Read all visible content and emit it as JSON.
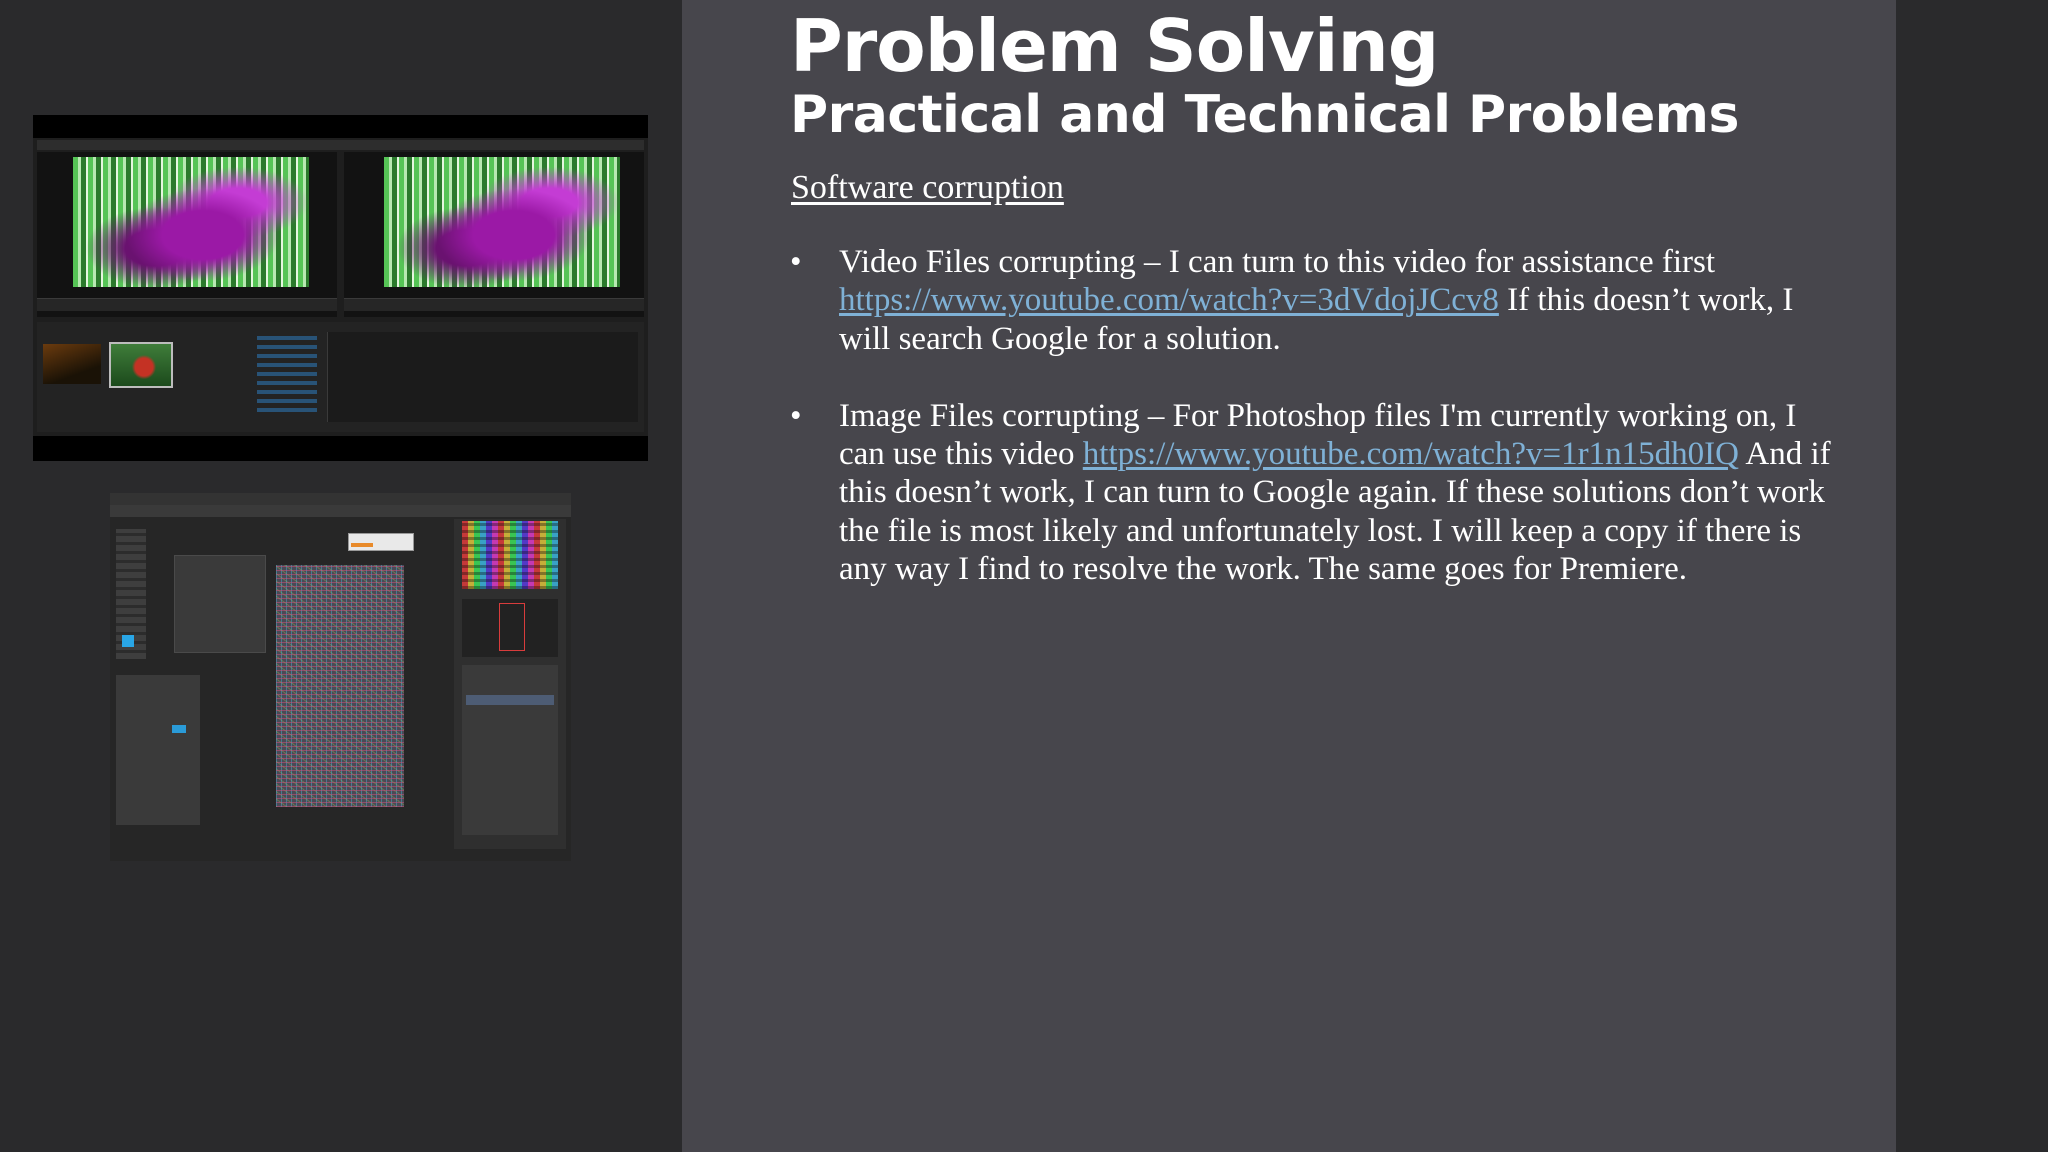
{
  "slide": {
    "title": "Problem Solving",
    "subtitle": "Practical and Technical Problems",
    "section_heading": "Software corruption",
    "bullets": [
      {
        "before": "Video Files corrupting – I can turn to this video for assistance first ",
        "link": "https://www.youtube.com/watch?v=3dVdojJCcv8",
        "after": " If this doesn’t work, I will search Google for a solution."
      },
      {
        "before": "Image Files corrupting – For Photoshop files I'm currently working on, I can use this video ",
        "link": "https://www.youtube.com/watch?v=1r1n15dh0IQ",
        "after": " And if this doesn’t work, I can turn to Google again. If these solutions don’t work the file is most likely and unfortunately lost. I will keep a copy if there is any way I find to resolve the work. The same goes for Premiere."
      }
    ]
  },
  "images": [
    {
      "name": "premiere-pro-screenshot",
      "depicts": "video editor showing corrupted green and magenta footage"
    },
    {
      "name": "photoshop-screenshot",
      "depicts": "image editor showing corrupted noisy canvas"
    }
  ],
  "colors": {
    "background": "#2a2a2c",
    "content_panel": "#47464c",
    "text": "#ffffff",
    "link": "#7fb1d6"
  }
}
